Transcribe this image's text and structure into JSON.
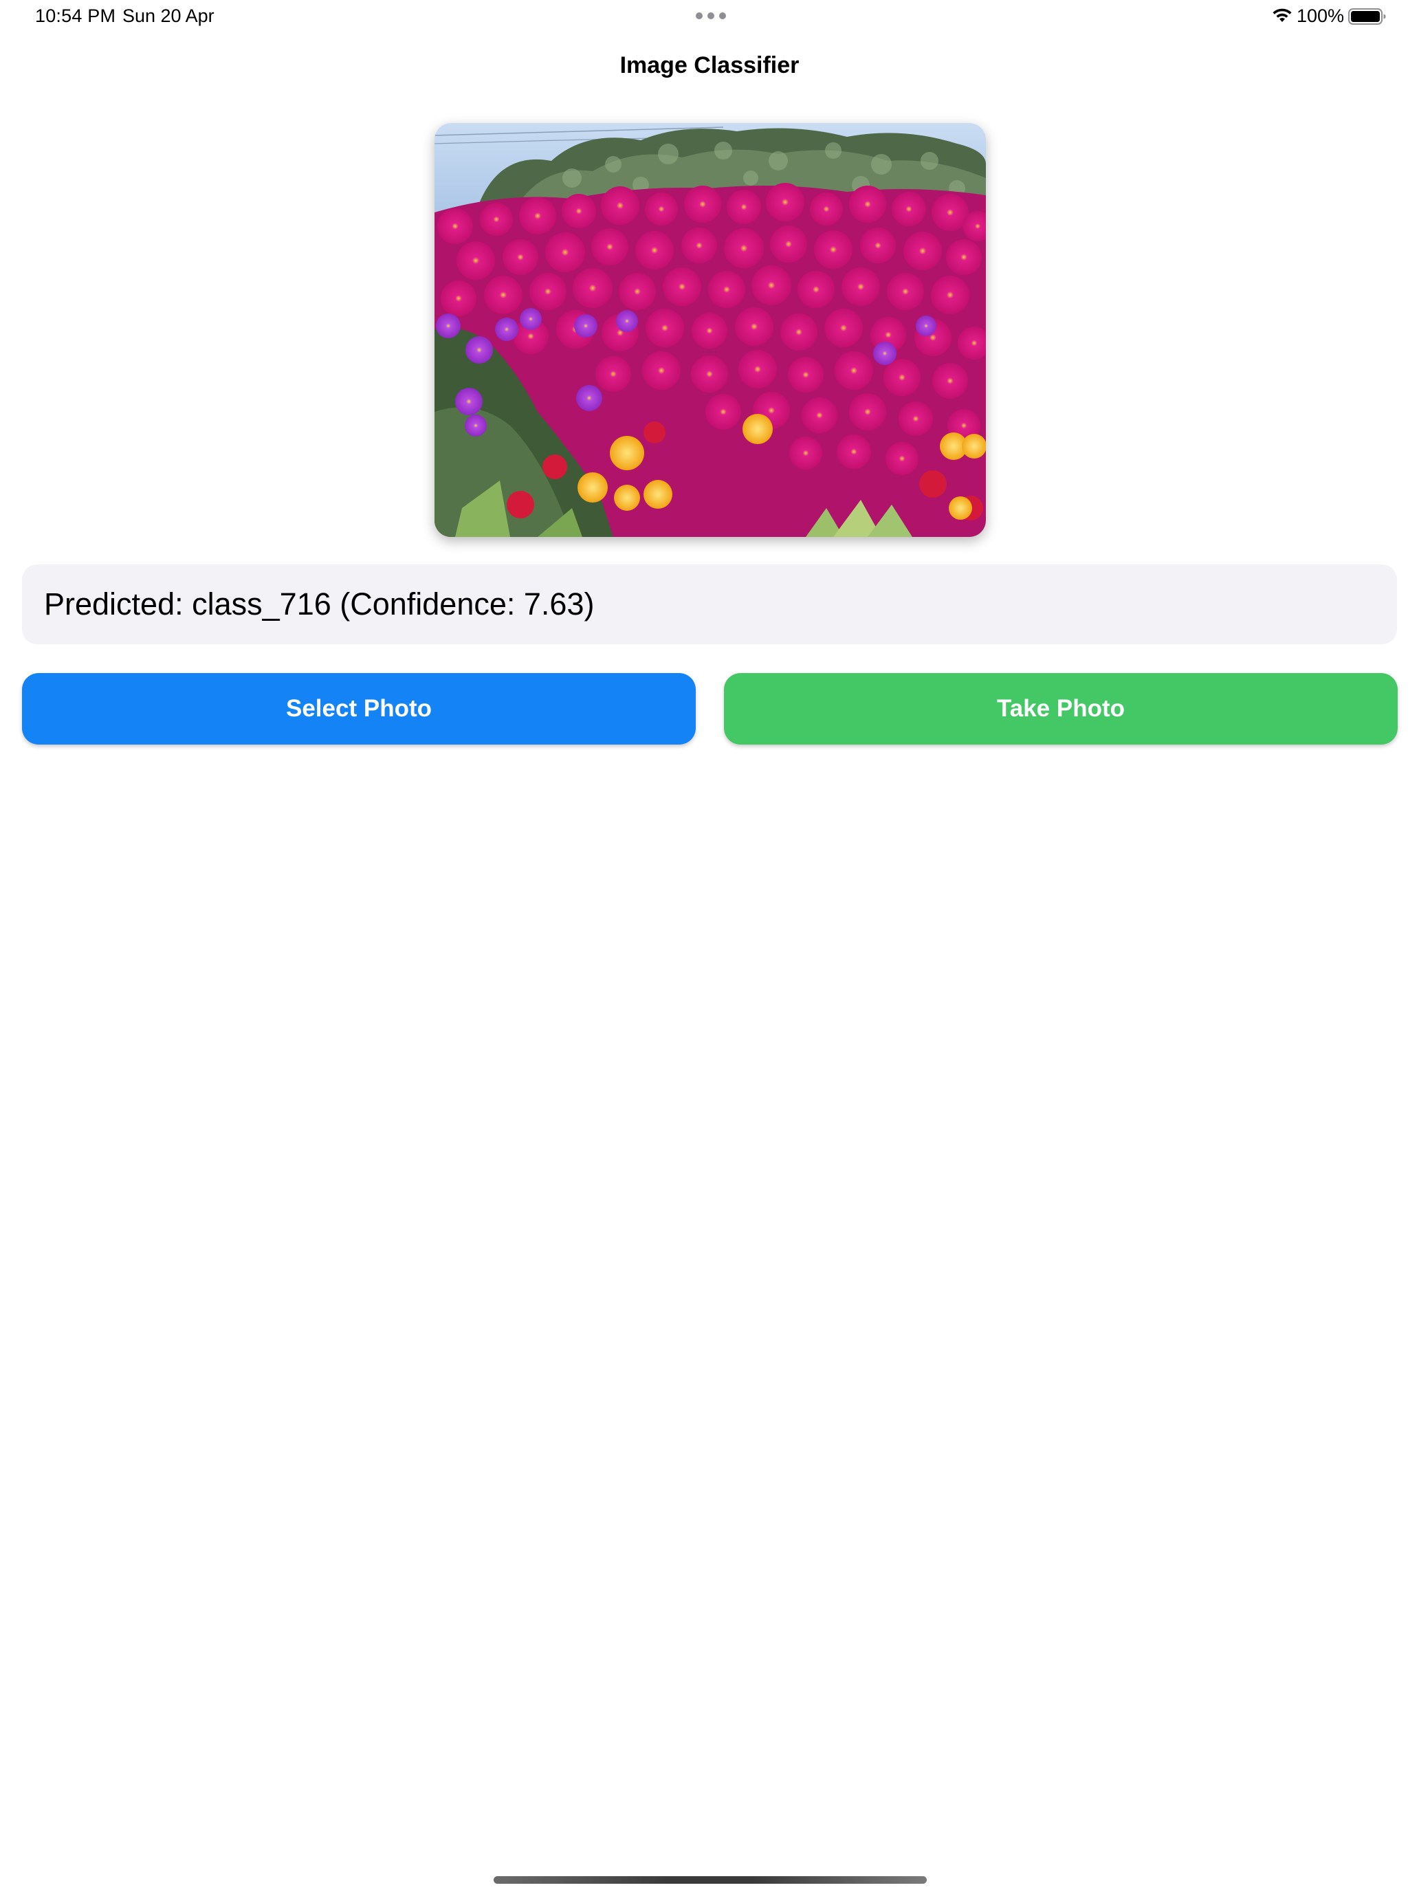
{
  "status_bar": {
    "time": "10:54 PM",
    "date": "Sun 20 Apr",
    "battery_percent": "100%",
    "battery_level": 1.0,
    "wifi_icon": "wifi-icon",
    "battery_icon": "battery-icon",
    "multitask_icon": "multitasking-dots-icon"
  },
  "nav": {
    "title": "Image Classifier"
  },
  "photo": {
    "subject": "flower-field-photo"
  },
  "prediction": {
    "text": "Predicted: class_716 (Confidence: 7.63)"
  },
  "buttons": {
    "select_label": "Select Photo",
    "take_label": "Take Photo",
    "select_color": "#1383f5",
    "take_color": "#44c765"
  }
}
